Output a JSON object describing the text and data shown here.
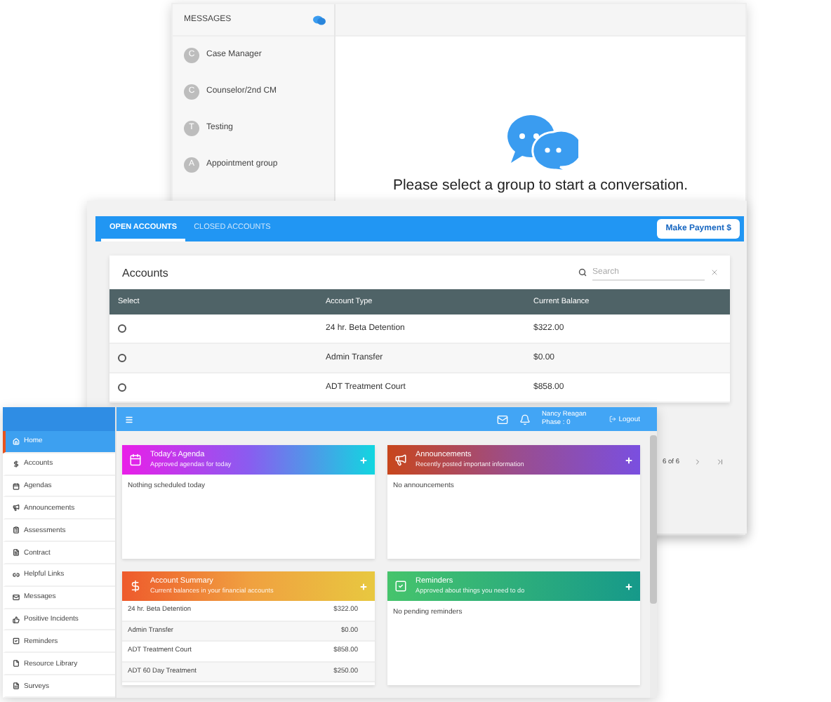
{
  "messages_window": {
    "header": "MESSAGES",
    "groups": [
      {
        "initial": "C",
        "name": "Case Manager"
      },
      {
        "initial": "C",
        "name": "Counselor/2nd CM"
      },
      {
        "initial": "T",
        "name": "Testing"
      },
      {
        "initial": "A",
        "name": "Appointment group"
      }
    ],
    "empty_prompt": "Please select a group to start a conversation."
  },
  "accounts_window": {
    "tabs": [
      {
        "label": "OPEN ACCOUNTS",
        "selected": true
      },
      {
        "label": "CLOSED ACCOUNTS",
        "selected": false
      }
    ],
    "make_payment": "Make Payment $",
    "title": "Accounts",
    "search": {
      "placeholder": "Search"
    },
    "columns": [
      "Select",
      "Account Type",
      "Current Balance"
    ],
    "rows": [
      {
        "selected": false,
        "account_type": "24 hr. Beta Detention",
        "balance": "$322.00"
      },
      {
        "selected": false,
        "account_type": "Admin Transfer",
        "balance": "$0.00"
      },
      {
        "selected": false,
        "account_type": "ADT Treatment Court",
        "balance": "$858.00"
      }
    ],
    "pagination": "6 of 6"
  },
  "dashboard": {
    "user": {
      "name": "Nancy Reagan",
      "phase": "Phase : 0"
    },
    "logout": "Logout",
    "nav": [
      {
        "label": "Home",
        "selected": true
      },
      {
        "label": "Accounts",
        "selected": false
      },
      {
        "label": "Agendas",
        "selected": false
      },
      {
        "label": "Announcements",
        "selected": false
      },
      {
        "label": "Assessments",
        "selected": false
      },
      {
        "label": "Contract",
        "selected": false
      },
      {
        "label": "Helpful Links",
        "selected": false
      },
      {
        "label": "Messages",
        "selected": false
      },
      {
        "label": "Positive Incidents",
        "selected": false
      },
      {
        "label": "Reminders",
        "selected": false
      },
      {
        "label": "Resource Library",
        "selected": false
      },
      {
        "label": "Surveys",
        "selected": false
      }
    ],
    "cards": [
      {
        "kind": "empty",
        "title": "Today's Agenda",
        "subtitle": "Approved agendas for today",
        "message": "Nothing scheduled today"
      },
      {
        "kind": "empty",
        "title": "Announcements",
        "subtitle": "Recently posted important information",
        "message": "No announcements"
      },
      {
        "kind": "list",
        "title": "Account Summary",
        "subtitle": "Current balances in your financial accounts",
        "items": [
          {
            "name": "24 hr. Beta Detention",
            "amount": "$322.00"
          },
          {
            "name": "Admin Transfer",
            "amount": "$0.00"
          },
          {
            "name": "ADT Treatment Court",
            "amount": "$858.00"
          },
          {
            "name": "ADT 60 Day Treatment",
            "amount": "$250.00"
          }
        ]
      },
      {
        "kind": "empty",
        "title": "Reminders",
        "subtitle": "Approved about things you need to do",
        "message": "No pending reminders"
      }
    ]
  }
}
